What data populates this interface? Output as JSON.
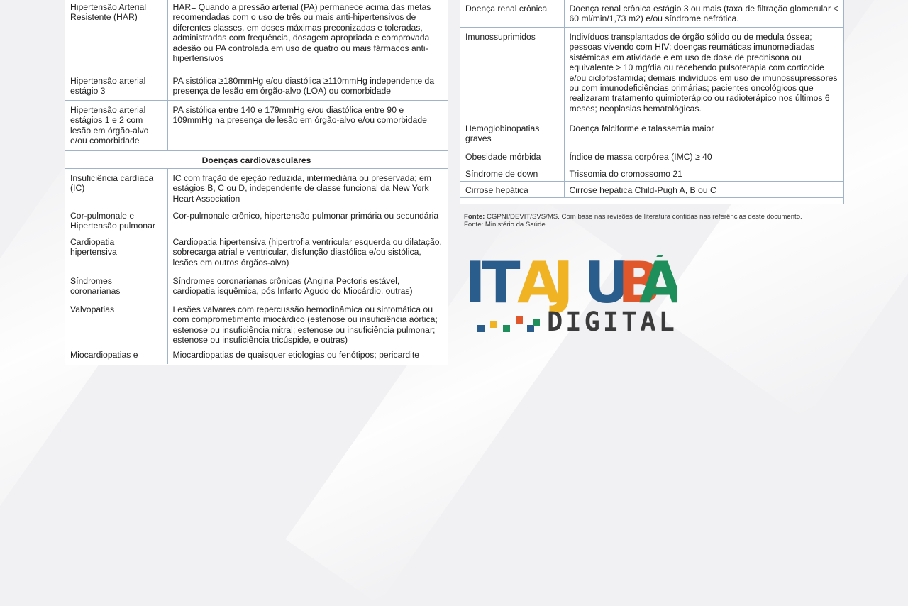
{
  "left_table": {
    "rows_top": [
      {
        "condition": "Hipertensão Arterial Resistente (HAR)",
        "criteria": "HAR= Quando a pressão arterial (PA) permanece acima das metas recomendadas com o uso de três ou mais anti-hipertensivos de diferentes classes, em doses máximas preconizadas e toleradas, administradas com frequência, dosagem apropriada e comprovada adesão ou PA controlada em uso de quatro ou mais fármacos anti-hipertensivos"
      },
      {
        "condition": "Hipertensão arterial estágio 3",
        "criteria": "PA sistólica ≥180mmHg e/ou diastólica ≥110mmHg independente da presença de lesão em órgão-alvo (LOA) ou comorbidade"
      },
      {
        "condition": "Hipertensão arterial estágios 1 e 2 com lesão em órgão-alvo e/ou comorbidade",
        "criteria": "PA sistólica entre 140 e 179mmHg e/ou diastólica entre 90 e 109mmHg na presença de lesão em órgão-alvo e/ou comorbidade"
      }
    ],
    "section_title": "Doenças cardiovasculares",
    "rows_cardio": [
      {
        "condition": "Insuficiência cardíaca (IC)",
        "criteria": "IC com fração de ejeção reduzida, intermediária ou preservada; em estágios B, C ou D, independente de classe funcional da New York Heart Association"
      },
      {
        "condition": "Cor-pulmonale e Hipertensão pulmonar",
        "criteria": "Cor-pulmonale crônico, hipertensão pulmonar primária ou secundária"
      },
      {
        "condition": "Cardiopatia hipertensiva",
        "criteria": "Cardiopatia hipertensiva (hipertrofia ventricular esquerda ou dilatação, sobrecarga atrial e ventricular, disfunção diastólica e/ou sistólica, lesões em outros órgãos-alvo)"
      },
      {
        "condition": "Síndromes coronarianas",
        "criteria": "Síndromes coronarianas crônicas (Angina Pectoris estável, cardiopatia isquêmica, pós Infarto Agudo do Miocárdio, outras)"
      },
      {
        "condition": "Valvopatias",
        "criteria": "Lesões valvares com repercussão hemodinâmica ou sintomática ou com comprometimento miocárdico (estenose ou insuficiência aórtica; estenose ou insuficiência mitral; estenose ou insuficiência pulmonar; estenose ou insuficiência tricúspide, e outras)"
      },
      {
        "condition": "Miocardiopatias e",
        "criteria": "Miocardiopatias de quaisquer etiologias ou fenótipos; pericardite"
      }
    ]
  },
  "right_table": {
    "rows": [
      {
        "condition": "Doença renal crônica",
        "criteria": "Doença renal crônica estágio 3 ou mais (taxa de filtração glomerular < 60 ml/min/1,73 m2) e/ou síndrome nefrótica."
      },
      {
        "condition": "Imunossuprimidos",
        "criteria": "Indivíduos transplantados de órgão sólido ou de medula óssea; pessoas vivendo com HIV; doenças reumáticas imunomediadas sistêmicas em atividade e em uso de dose de prednisona ou equivalente > 10 mg/dia ou recebendo pulsoterapia com corticoide e/ou ciclofosfamida; demais indivíduos em uso de imunossupressores ou com imunodeficiências primárias; pacientes oncológicos que realizaram tratamento quimioterápico ou radioterápico nos últimos 6 meses; neoplasias hematológicas."
      },
      {
        "condition": "Hemoglobinopatias graves",
        "criteria": "Doença falciforme e talassemia maior"
      },
      {
        "condition": "Obesidade mórbida",
        "criteria": "Índice de massa corpórea (IMC) ≥ 40"
      },
      {
        "condition": "Síndrome de down",
        "criteria": "Trissomia do cromossomo 21"
      },
      {
        "condition": "Cirrose hepática",
        "criteria": "Cirrose hepática Child-Pugh A, B ou C"
      }
    ]
  },
  "source": {
    "label": "Fonte:",
    "text": "CGPNI/DEVIT/SVS/MS. Com base nas revisões de literatura contidas nas referências deste documento.",
    "line2": "Fonte: Ministério da Saúde"
  },
  "logo": {
    "letters": [
      "I",
      "T",
      "A",
      "J",
      "U",
      "B",
      "Á"
    ],
    "letter_colors": [
      "#2b5d8c",
      "#2b5d8c",
      "#f0b324",
      "#f0b324",
      "#2b5d8c",
      "#e0572b",
      "#1e8f5a"
    ],
    "subtitle": "DIGITAL",
    "subtitle_color": "#3b3b3b",
    "pixel_colors": [
      "#2b5d8c",
      "#f0b324",
      "#1e8f5a",
      "#e0572b",
      "#2b5d8c",
      "#1e8f5a"
    ]
  }
}
